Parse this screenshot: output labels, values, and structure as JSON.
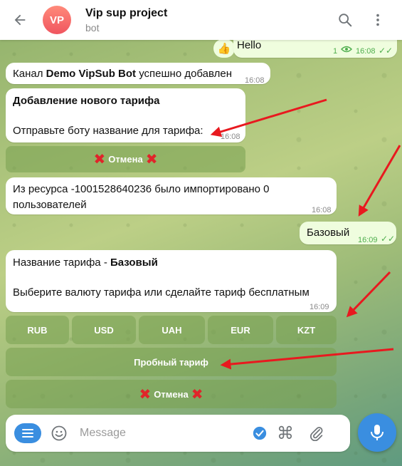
{
  "header": {
    "back_label": "←",
    "avatar_initials": "VP",
    "title": "Vip sup project",
    "subtitle": "bot"
  },
  "messages": {
    "hello": {
      "text": "Hello",
      "views": "1",
      "time": "16:08"
    },
    "channel_added": {
      "prefix": "Канал ",
      "name": "Demo VipSub Bot",
      "suffix": " успешно добавлен",
      "time": "16:08"
    },
    "add_tariff": {
      "title": "Добавление нового тарифа",
      "body": "Отправьте боту название для тарифа:",
      "time": "16:08"
    },
    "cancel_1": {
      "label": "Отмена",
      "mark": "✖"
    },
    "imported": {
      "text": "Из ресурса -1001528640236 было импортировано 0 пользователей",
      "time": "16:08"
    },
    "base_reply": {
      "text": "Базовый",
      "time": "16:09"
    },
    "tariff_name": {
      "prefix": "Название тарифа - ",
      "name": "Базовый",
      "body": "Выберите валюту тарифа или сделайте тариф бесплатным",
      "time": "16:09"
    },
    "currencies": [
      "RUB",
      "USD",
      "UAH",
      "EUR",
      "KZT"
    ],
    "trial": {
      "label": "Пробный тариф"
    },
    "cancel_2": {
      "label": "Отмена",
      "mark": "✖"
    }
  },
  "composer": {
    "placeholder": "Message"
  },
  "colors": {
    "accent": "#3a8ee0",
    "annotation_arrow": "#e8191f",
    "outgoing_bubble": "#effdde"
  }
}
